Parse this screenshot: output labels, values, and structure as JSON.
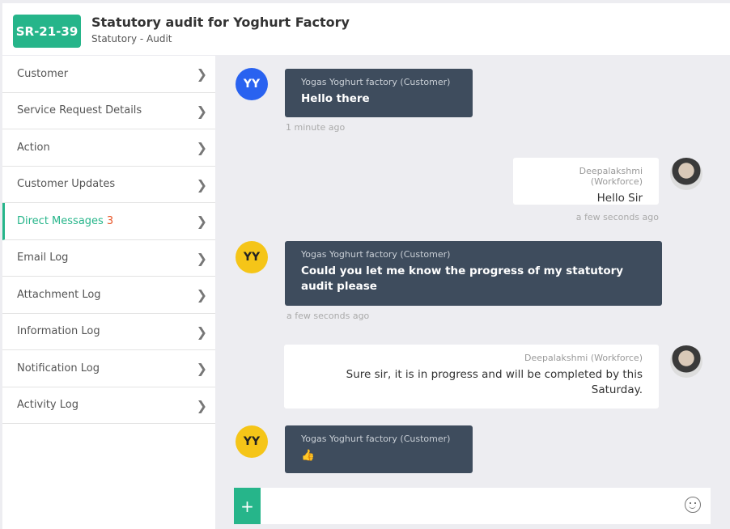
{
  "header": {
    "id": "SR-21-39",
    "title": "Statutory audit for Yoghurt Factory",
    "subtitle": "Statutory - Audit"
  },
  "sidebar": {
    "items": [
      {
        "label": "Customer"
      },
      {
        "label": "Service Request Details"
      },
      {
        "label": "Action"
      },
      {
        "label": "Customer Updates"
      },
      {
        "label": "Direct Messages",
        "count": "3",
        "active": true
      },
      {
        "label": "Email Log"
      },
      {
        "label": "Attachment Log"
      },
      {
        "label": "Information Log"
      },
      {
        "label": "Notification Log"
      },
      {
        "label": "Activity Log"
      }
    ]
  },
  "messages": [
    {
      "sender": "Yogas Yoghurt factory (Customer)",
      "initials": "YY",
      "avatar_color": "#2962f0",
      "text": "Hello there",
      "time": "1 minute ago"
    },
    {
      "sender": "Deepalakshmi (Workforce)",
      "text": "Hello Sir",
      "time": "a few seconds ago"
    },
    {
      "sender": "Yogas Yoghurt factory (Customer)",
      "initials": "YY",
      "avatar_color": "#f5c518",
      "text": "Could you let me know the progress of my statutory audit please",
      "time": "a few seconds ago"
    },
    {
      "sender": "Deepalakshmi (Workforce)",
      "text": "Sure sir, it is in progress and will be completed by this Saturday."
    },
    {
      "sender": "Yogas Yoghurt factory (Customer)",
      "initials": "YY",
      "avatar_color": "#f5c518",
      "text": "👍"
    }
  ],
  "composer": {
    "plus": "+",
    "value": "",
    "emoji_icon": "smiley-icon"
  },
  "colors": {
    "accent": "#26b58a",
    "bubble_dark": "#3e4c5d",
    "count": "#e8572a"
  }
}
